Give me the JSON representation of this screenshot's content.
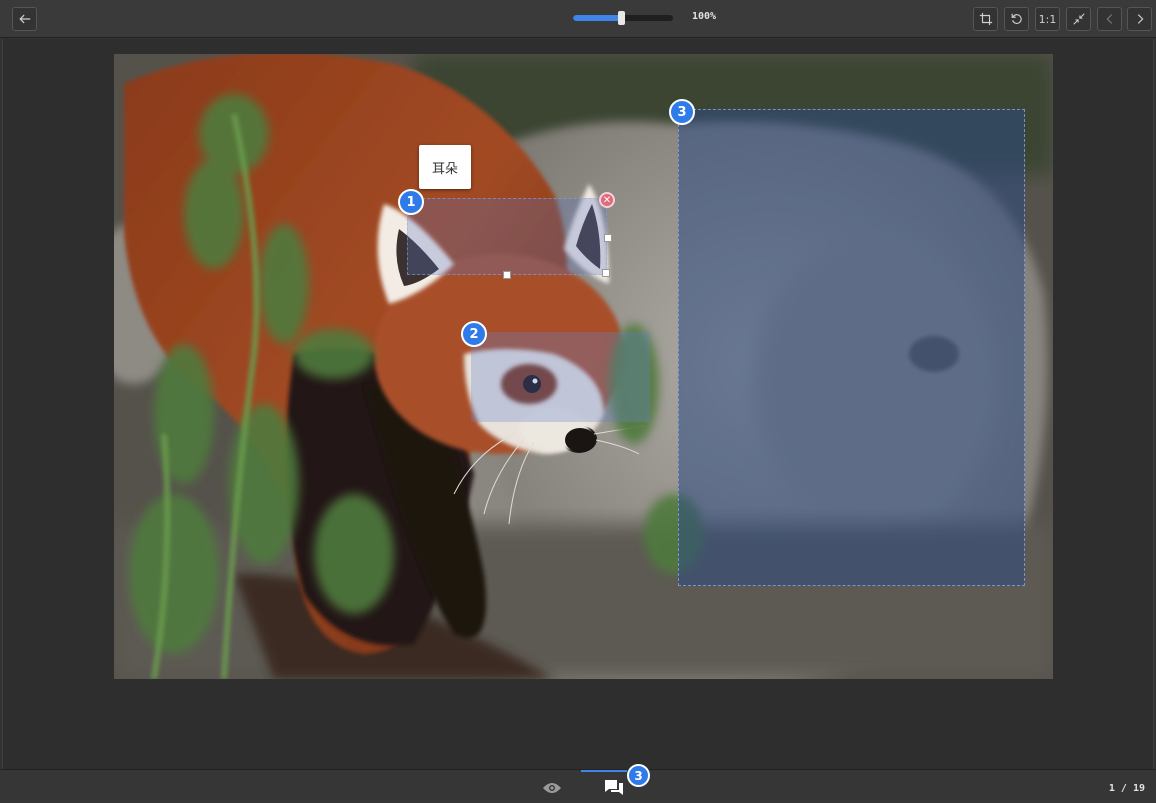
{
  "toolbar": {
    "zoom_text": "100%",
    "zoom_fraction": 0.48,
    "buttons": {
      "back": "arrow-left-icon",
      "crop": "crop-icon",
      "rotate": "rotate-icon",
      "actual_size_label": "1:1",
      "fit": "fit-screen-icon",
      "prev": "chevron-left-icon",
      "next": "chevron-right-icon"
    }
  },
  "annotations": [
    {
      "number": "1",
      "label": "耳朵"
    },
    {
      "number": "2"
    },
    {
      "number": "3"
    }
  ],
  "bottombar": {
    "comment_count": "3",
    "pager": "1 / 19"
  },
  "colors": {
    "accent": "#3f86e8",
    "marker": "#2f7bea",
    "delete": "#e06b7c"
  }
}
